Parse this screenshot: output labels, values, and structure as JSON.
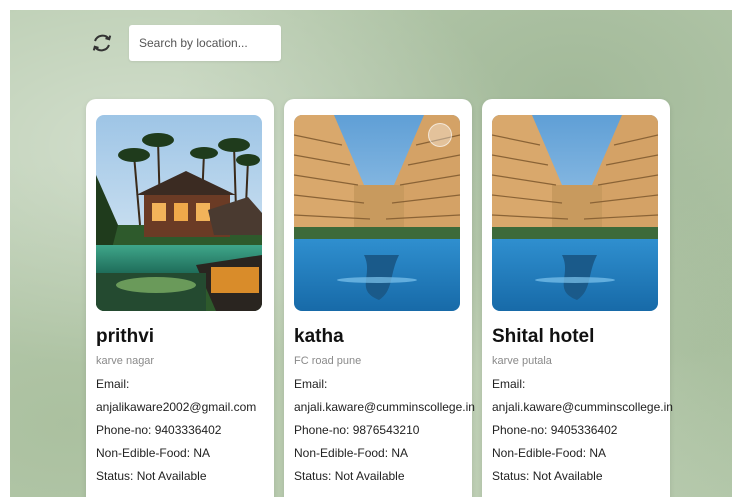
{
  "search": {
    "placeholder": "Search by location..."
  },
  "icons": {
    "refresh": "refresh-icon",
    "lens": "image-search-icon"
  },
  "listings": [
    {
      "name": "prithvi",
      "location": "karve nagar",
      "email_label": "Email:",
      "email": "anjalikaware2002@gmail.com",
      "phone": "Phone-no: 9403336402",
      "non_edible": "Non-Edible-Food: NA",
      "status": "Status: Not Available"
    },
    {
      "name": "katha",
      "location": "FC road pune",
      "email_label": "Email:",
      "email": "anjali.kaware@cumminscollege.in",
      "phone": "Phone-no: 9876543210",
      "non_edible": "Non-Edible-Food: NA",
      "status": "Status: Not Available"
    },
    {
      "name": "Shital hotel",
      "location": "karve putala",
      "email_label": "Email:",
      "email": "anjali.kaware@cumminscollege.in",
      "phone": "Phone-no: 9405336402",
      "non_edible": "Non-Edible-Food: NA",
      "status": "Status: Not Available"
    }
  ]
}
